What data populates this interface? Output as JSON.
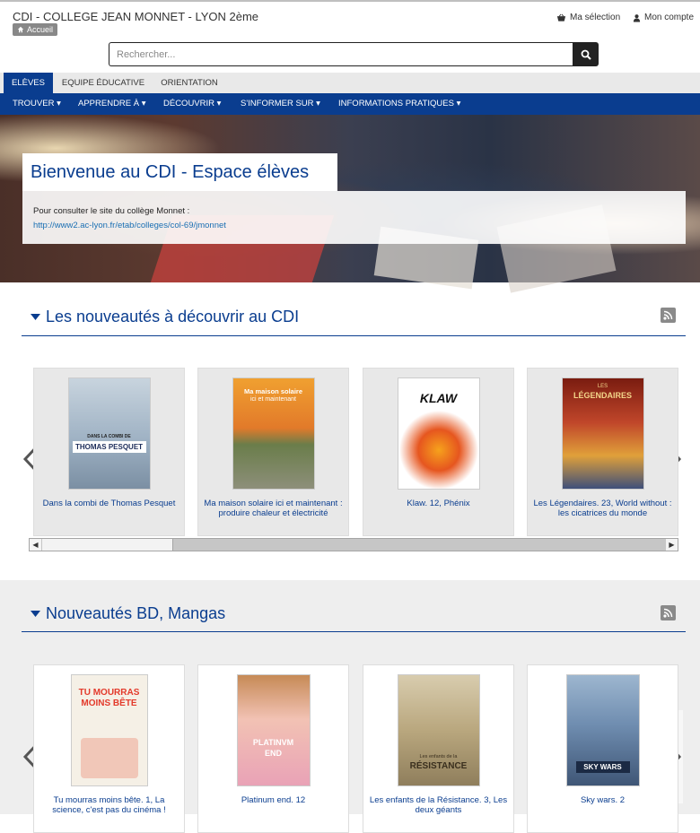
{
  "site_title": "CDI - COLLEGE JEAN MONNET - LYON 2ème",
  "breadcrumb": "Accueil",
  "util": {
    "selection": "Ma sélection",
    "account": "Mon compte"
  },
  "search": {
    "placeholder": "Rechercher..."
  },
  "tabs": [
    "ELÈVES",
    "EQUIPE ÉDUCATIVE",
    "ORIENTATION"
  ],
  "nav": [
    "TROUVER",
    "APPRENDRE À",
    "DÉCOUVRIR",
    "S'INFORMER SUR",
    "INFORMATIONS PRATIQUES"
  ],
  "hero": {
    "title": "Bienvenue au CDI - Espace élèves",
    "text": "Pour consulter le site du collège Monnet :",
    "link": "http://www2.ac-lyon.fr/etab/colleges/col-69/jmonnet"
  },
  "sections": [
    {
      "title": "Les nouveautés à découvrir au CDI",
      "items": [
        {
          "caption": "Dans la combi de Thomas Pesquet",
          "cover_text": [
            "DANS LA COMBI DE",
            "THOMAS PESQUET"
          ],
          "color": "#a9b9c8"
        },
        {
          "caption": "Ma maison solaire ici et maintenant : produire chaleur et électricité",
          "cover_text": [
            "Ma maison solaire",
            "ici et maintenant"
          ],
          "color": "#e8823a"
        },
        {
          "caption": "Klaw. 12, Phénix",
          "cover_text": [
            "KLAW"
          ],
          "color": "#f7f3ee"
        },
        {
          "caption": "Les Légendaires. 23, World without : les cicatrices du monde",
          "cover_text": [
            "LES",
            "LÉGENDAIRES"
          ],
          "color": "#b03a24"
        }
      ]
    },
    {
      "title": "Nouveautés BD, Mangas",
      "items": [
        {
          "caption": "Tu mourras moins bête. 1, La science, c'est pas du cinéma !",
          "cover_text": [
            "TU MOURRAS",
            "MOINS BÊTE"
          ],
          "color": "#f4efe6"
        },
        {
          "caption": "Platinum end. 12",
          "cover_text": [
            "PLATINVM",
            "END"
          ],
          "color": "#f0b3c3"
        },
        {
          "caption": "Les enfants de la Résistance. 3, Les deux géants",
          "cover_text": [
            "Les enfants de la",
            "RÉSISTANCE"
          ],
          "color": "#cdbf9e"
        },
        {
          "caption": "Sky wars. 2",
          "cover_text": [
            "SKY WARS"
          ],
          "color": "#6f8db0"
        }
      ]
    }
  ]
}
